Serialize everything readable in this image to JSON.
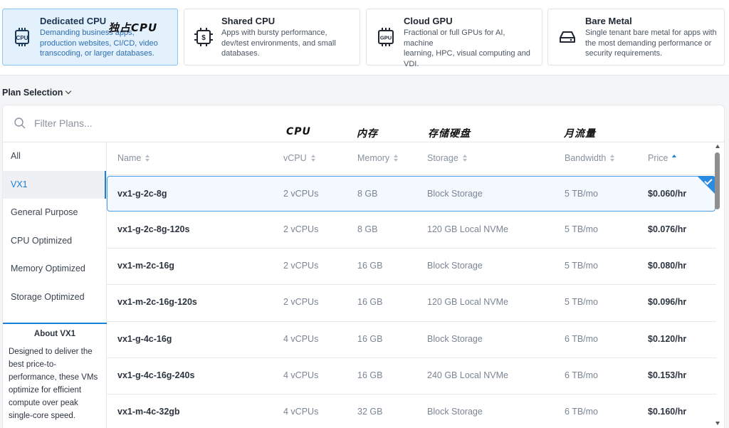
{
  "categories": [
    {
      "id": "dedicated",
      "title": "Dedicated CPU",
      "annotation": "独占CPU",
      "desc": [
        "Demanding business apps,",
        "production websites, CI/CD, video",
        "transcoding, or larger databases."
      ],
      "icon": "cpu-chip-icon",
      "active": true
    },
    {
      "id": "shared",
      "title": "Shared CPU",
      "desc": [
        "Apps with bursty performance,",
        "dev/test environments, and small",
        "databases."
      ],
      "icon": "shared-chip-icon",
      "active": false
    },
    {
      "id": "gpu",
      "title": "Cloud GPU",
      "desc": [
        "Fractional or full GPUs for AI, machine",
        "learning, HPC, visual computing and",
        "VDI."
      ],
      "icon": "gpu-chip-icon",
      "active": false
    },
    {
      "id": "bare",
      "title": "Bare Metal",
      "desc": [
        "Single tenant bare metal for apps with",
        "the most demanding performance or",
        "security requirements."
      ],
      "icon": "server-drive-icon",
      "active": false
    }
  ],
  "plan_selection": {
    "label": "Plan Selection"
  },
  "search": {
    "placeholder": "Filter Plans..."
  },
  "annotations": {
    "cpu": "CPU",
    "memory": "内存",
    "storage": "存储硬盘",
    "bandwidth": "月流量"
  },
  "sidebar": {
    "items": [
      {
        "label": "All",
        "active": false
      },
      {
        "label": "VX1",
        "active": true
      },
      {
        "label": "General Purpose",
        "active": false
      },
      {
        "label": "CPU Optimized",
        "active": false
      },
      {
        "label": "Memory Optimized",
        "active": false
      },
      {
        "label": "Storage Optimized",
        "active": false
      }
    ],
    "about_title": "About VX1",
    "about_text": [
      "Designed to deliver the",
      "best price-to-",
      "performance, these VMs",
      "optimize for efficient",
      "compute over peak",
      "single-core speed."
    ]
  },
  "table": {
    "headers": {
      "name": "Name",
      "vcpu": "vCPU",
      "memory": "Memory",
      "storage": "Storage",
      "bandwidth": "Bandwidth",
      "price": "Price"
    },
    "rows": [
      {
        "name": "vx1-g-2c-8g",
        "vcpu": "2 vCPUs",
        "memory": "8 GB",
        "storage": "Block Storage",
        "bandwidth": "5 TB/mo",
        "price": "$0.060/hr",
        "selected": true
      },
      {
        "name": "vx1-g-2c-8g-120s",
        "vcpu": "2 vCPUs",
        "memory": "8 GB",
        "storage": "120 GB Local NVMe",
        "bandwidth": "5 TB/mo",
        "price": "$0.076/hr"
      },
      {
        "name": "vx1-m-2c-16g",
        "vcpu": "2 vCPUs",
        "memory": "16 GB",
        "storage": "Block Storage",
        "bandwidth": "5 TB/mo",
        "price": "$0.080/hr"
      },
      {
        "name": "vx1-m-2c-16g-120s",
        "vcpu": "2 vCPUs",
        "memory": "16 GB",
        "storage": "120 GB Local NVMe",
        "bandwidth": "5 TB/mo",
        "price": "$0.096/hr"
      },
      {
        "name": "vx1-g-4c-16g",
        "vcpu": "4 vCPUs",
        "memory": "16 GB",
        "storage": "Block Storage",
        "bandwidth": "6 TB/mo",
        "price": "$0.120/hr"
      },
      {
        "name": "vx1-g-4c-16g-240s",
        "vcpu": "4 vCPUs",
        "memory": "16 GB",
        "storage": "240 GB Local NVMe",
        "bandwidth": "6 TB/mo",
        "price": "$0.153/hr"
      },
      {
        "name": "vx1-m-4c-32gb",
        "vcpu": "4 vCPUs",
        "memory": "32 GB",
        "storage": "Block Storage",
        "bandwidth": "6 TB/mo",
        "price": "$0.160/hr"
      }
    ]
  },
  "colors": {
    "accent": "#1a7fd6",
    "active_card_bg": "#e3f1fd"
  }
}
